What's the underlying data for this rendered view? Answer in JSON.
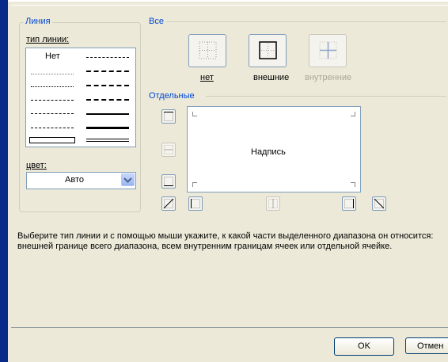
{
  "line_group": {
    "title": "Линия",
    "type_label": "тип линии:",
    "none_label": "Нет",
    "color_label": "цвет:",
    "color_value": "Авто"
  },
  "presets_group": {
    "title": "Все",
    "none_label": "нет",
    "outline_label": "внешние",
    "inside_label": "внутренние"
  },
  "individual_group": {
    "title": "Отдельные",
    "preview_text": "Надпись"
  },
  "description": "Выберите тип линии и с помощью мыши укажите, к какой части выделенного диапазона он относится: внешней границе всего диапазона, всем внутренним границам ячеек или отдельной ячейке.",
  "buttons": {
    "ok": "OK",
    "cancel": "Отмен"
  },
  "colors": {
    "label_blue": "#0046d5",
    "dialog_bg": "#ece9d8",
    "frame_blue": "#0a2a8a"
  },
  "icons": {
    "preset_none": "border-none-icon",
    "preset_outline": "border-outline-icon",
    "preset_inside": "border-inside-icon"
  }
}
